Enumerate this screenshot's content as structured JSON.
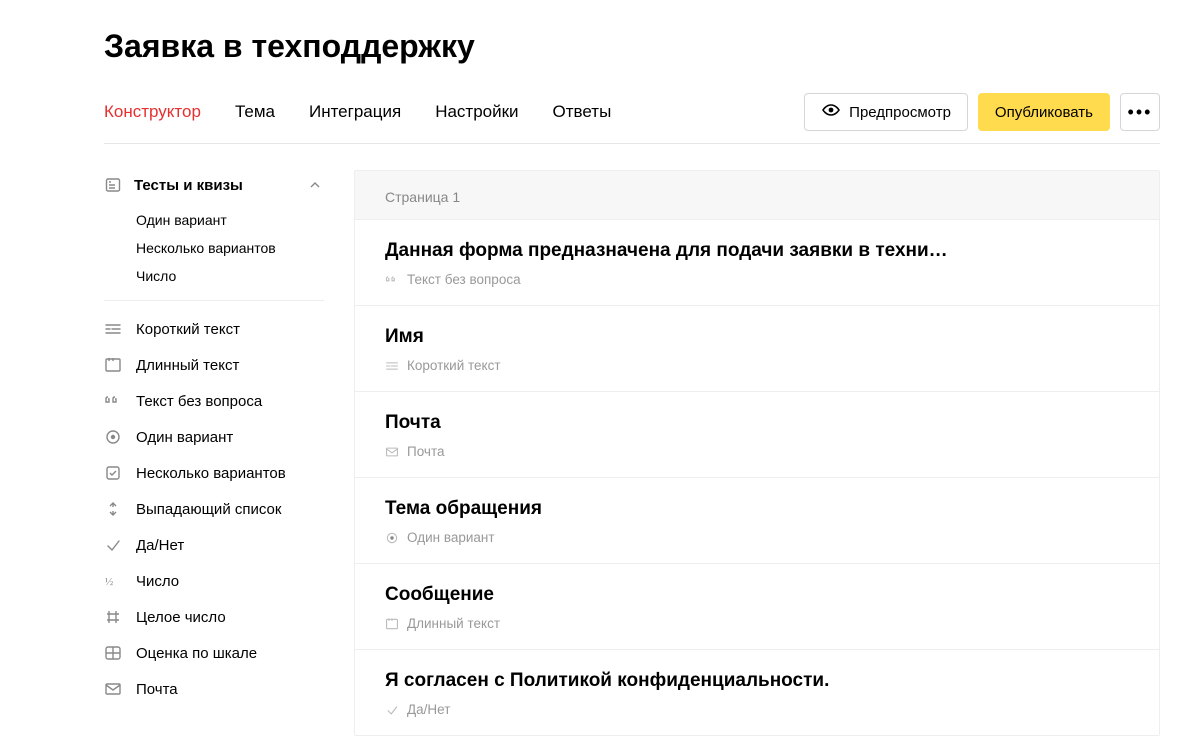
{
  "title": "Заявка в техподдержку",
  "tabs": [
    {
      "label": "Конструктор",
      "active": true
    },
    {
      "label": "Тема",
      "active": false
    },
    {
      "label": "Интеграция",
      "active": false
    },
    {
      "label": "Настройки",
      "active": false
    },
    {
      "label": "Ответы",
      "active": false
    }
  ],
  "actions": {
    "preview": "Предпросмотр",
    "publish": "Опубликовать"
  },
  "sidebar": {
    "group": {
      "label": "Тесты и квизы",
      "items": [
        {
          "label": "Один вариант"
        },
        {
          "label": "Несколько вариантов"
        },
        {
          "label": "Число"
        }
      ]
    },
    "fieldTypes": [
      {
        "icon": "short-text",
        "label": "Короткий текст"
      },
      {
        "icon": "long-text",
        "label": "Длинный текст"
      },
      {
        "icon": "quote",
        "label": "Текст без вопроса"
      },
      {
        "icon": "radio",
        "label": "Один вариант"
      },
      {
        "icon": "checkbox",
        "label": "Несколько вариантов"
      },
      {
        "icon": "dropdown",
        "label": "Выпадающий список"
      },
      {
        "icon": "yesno",
        "label": "Да/Нет"
      },
      {
        "icon": "half",
        "label": "Число"
      },
      {
        "icon": "hash",
        "label": "Целое число"
      },
      {
        "icon": "grid",
        "label": "Оценка по шкале"
      },
      {
        "icon": "mail",
        "label": "Почта"
      }
    ]
  },
  "main": {
    "pageLabel": "Страница 1",
    "cards": [
      {
        "title": "Данная форма предназначена для подачи заявки в техни…",
        "type": "Текст без вопроса",
        "icon": "quote"
      },
      {
        "title": "Имя",
        "type": "Короткий текст",
        "icon": "short-text"
      },
      {
        "title": "Почта",
        "type": "Почта",
        "icon": "mail"
      },
      {
        "title": "Тема обращения",
        "type": "Один вариант",
        "icon": "radio"
      },
      {
        "title": "Сообщение",
        "type": "Длинный текст",
        "icon": "long-text"
      },
      {
        "title": "Я согласен с Политикой конфиденциальности.",
        "type": "Да/Нет",
        "icon": "yesno"
      }
    ]
  }
}
